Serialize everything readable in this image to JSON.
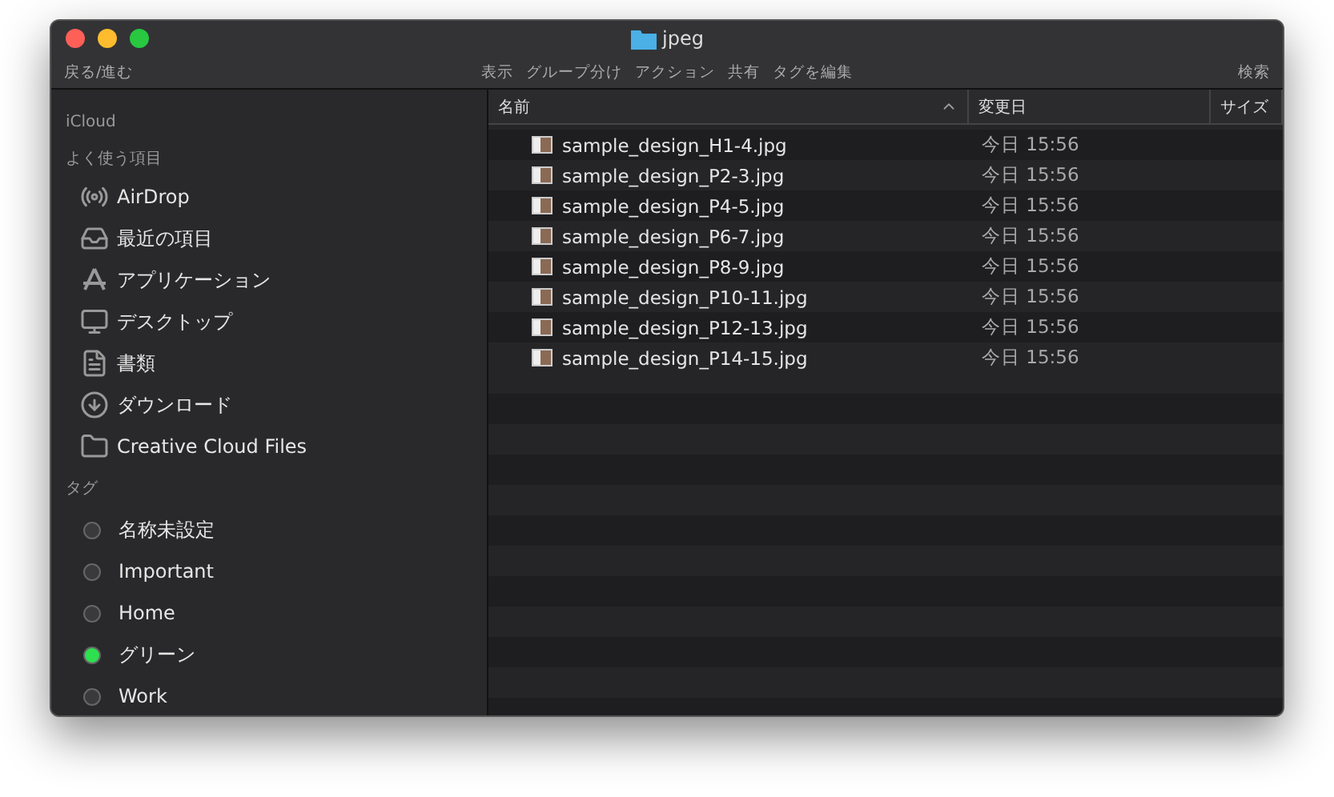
{
  "window": {
    "title": "jpeg"
  },
  "toolbar": {
    "left": [
      "戻る/進む"
    ],
    "center": [
      "表示",
      "グループ分け",
      "アクション",
      "共有",
      "タグを編集"
    ],
    "right": [
      "検索"
    ]
  },
  "sidebar": {
    "sections": [
      {
        "heading": "iCloud"
      },
      {
        "heading": "よく使う項目",
        "items": [
          {
            "label": "AirDrop",
            "kind": "airdrop"
          },
          {
            "label": "最近の項目",
            "kind": "recents"
          },
          {
            "label": "アプリケーション",
            "kind": "apps"
          },
          {
            "label": "デスクトップ",
            "kind": "desktop"
          },
          {
            "label": "書類",
            "kind": "documents"
          },
          {
            "label": "ダウンロード",
            "kind": "downloads"
          },
          {
            "label": "Creative Cloud Files",
            "kind": "folder"
          }
        ]
      },
      {
        "heading": "タグ",
        "items": [
          {
            "label": "名称未設定",
            "kind": "tag",
            "color": "#3a3a3c"
          },
          {
            "label": "Important",
            "kind": "tag",
            "color": "#3a3a3c"
          },
          {
            "label": "Home",
            "kind": "tag",
            "color": "#3a3a3c"
          },
          {
            "label": "グリーン",
            "kind": "tag",
            "color": "#2ee04f"
          },
          {
            "label": "Work",
            "kind": "tag",
            "color": "#3a3a3c"
          }
        ]
      }
    ]
  },
  "table": {
    "columns": [
      {
        "label": "名前",
        "sorted": true
      },
      {
        "label": "変更日",
        "sorted": false
      },
      {
        "label": "サイズ",
        "sorted": false
      }
    ],
    "rows": [
      {
        "name": "sample_design_H1-4.jpg",
        "modified": "今日 15:56"
      },
      {
        "name": "sample_design_P2-3.jpg",
        "modified": "今日 15:56"
      },
      {
        "name": "sample_design_P4-5.jpg",
        "modified": "今日 15:56"
      },
      {
        "name": "sample_design_P6-7.jpg",
        "modified": "今日 15:56"
      },
      {
        "name": "sample_design_P8-9.jpg",
        "modified": "今日 15:56"
      },
      {
        "name": "sample_design_P10-11.jpg",
        "modified": "今日 15:56"
      },
      {
        "name": "sample_design_P12-13.jpg",
        "modified": "今日 15:56"
      },
      {
        "name": "sample_design_P14-15.jpg",
        "modified": "今日 15:56"
      }
    ]
  }
}
